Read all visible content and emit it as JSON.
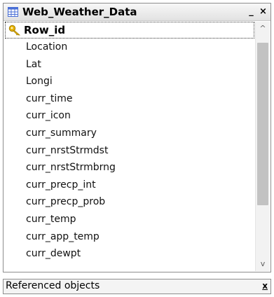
{
  "window": {
    "title": "Web_Weather_Data",
    "minimize_label": "_",
    "close_label": "×"
  },
  "columns": {
    "primary_key": "Row_id",
    "items": [
      "Location",
      "Lat",
      "Longi",
      "curr_time",
      "curr_icon",
      "curr_summary",
      "curr_nrstStrmdst",
      "curr_nrstStrmbrng",
      "curr_precp_int",
      "curr_precp_prob",
      "curr_temp",
      "curr_app_temp",
      "curr_dewpt"
    ]
  },
  "scrollbar": {
    "up_arrow": "^",
    "down_arrow": "v"
  },
  "footer": {
    "label": "Referenced objects",
    "close_label": "x"
  },
  "icons": {
    "table": "table-icon",
    "key": "key-icon"
  },
  "colors": {
    "key_icon": "#e8b400",
    "table_icon": "#4a6fd6"
  }
}
